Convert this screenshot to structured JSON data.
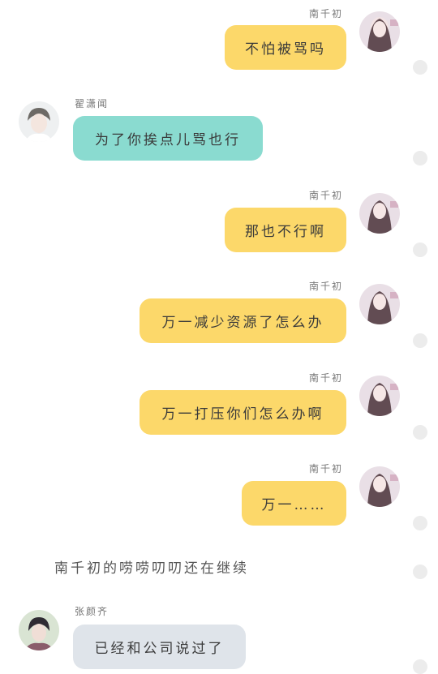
{
  "messages": [
    {
      "sender": "南千初",
      "text": "不怕被骂吗",
      "side": "right",
      "color": "#fcd86a"
    },
    {
      "sender": "翟潇闻",
      "text": "为了你挨点儿骂也行",
      "side": "left",
      "color": "#8adbd0"
    },
    {
      "sender": "南千初",
      "text": "那也不行啊",
      "side": "right",
      "color": "#fcd86a"
    },
    {
      "sender": "南千初",
      "text": "万一减少资源了怎么办",
      "side": "right",
      "color": "#fcd86a"
    },
    {
      "sender": "南千初",
      "text": "万一打压你们怎么办啊",
      "side": "right",
      "color": "#fcd86a"
    },
    {
      "sender": "南千初",
      "text": "万一……",
      "side": "right",
      "color": "#fcd86a"
    }
  ],
  "narration": "南千初的唠唠叨叨还在继续",
  "last_message": {
    "sender": "张颜齐",
    "text": "已经和公司说过了",
    "side": "left",
    "color": "#dfe4ea"
  }
}
